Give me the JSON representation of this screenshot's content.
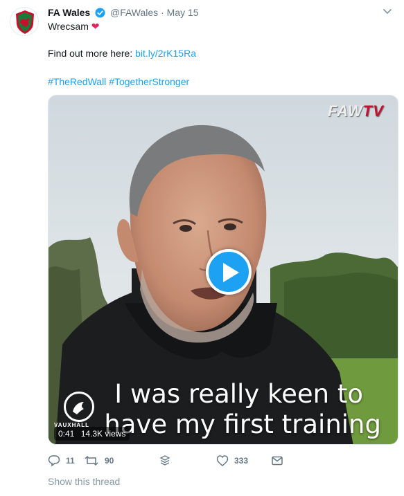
{
  "tweet": {
    "author_name": "FA Wales",
    "handle": "@FAWales",
    "separator": "·",
    "timestamp": "May 15",
    "text_line1": "Wrecsam",
    "heart_emoji": "❤",
    "text_line2": "Find out more here:",
    "link_text": "bit.ly/2rK15Ra",
    "hashtags": [
      "#TheRedWall",
      "#TogetherStronger"
    ]
  },
  "video": {
    "brand_prefix": "FAW",
    "brand_suffix": "TV",
    "caption_line1": "I was really keen to",
    "caption_line2": "have my first training",
    "sponsor_text": "VAUXHALL",
    "duration": "0:41",
    "views": "14.3K views"
  },
  "actions": {
    "reply_count": "11",
    "retweet_count": "90",
    "like_count": "333"
  },
  "footer": {
    "show_thread": "Show this thread"
  },
  "colors": {
    "link": "#1da1f2",
    "heart": "#e0245e",
    "secondary_text": "#657786",
    "brand_red": "#c8102e"
  },
  "icons": [
    "verified-badge-icon",
    "caret-down-icon",
    "play-icon",
    "reply-icon",
    "retweet-icon",
    "stack-icon",
    "like-icon",
    "direct-message-icon",
    "sponsor-logo-icon",
    "fa-wales-crest-icon"
  ]
}
